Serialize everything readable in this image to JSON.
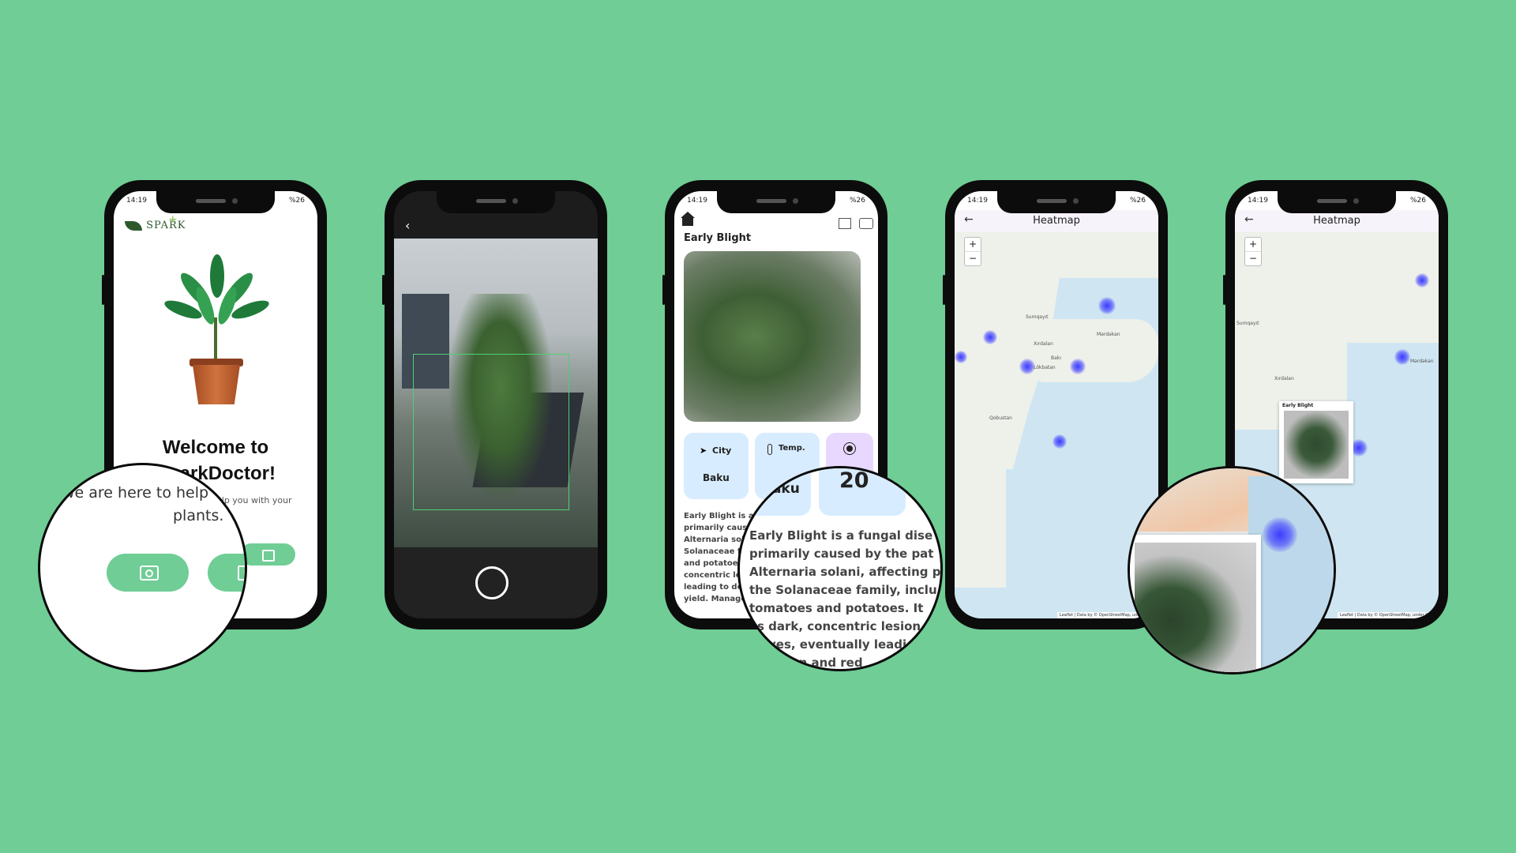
{
  "status": {
    "time": "14:19",
    "battery": "%26"
  },
  "welcome": {
    "logo": "SPARK",
    "title": "Welcome to SparkDoctor!",
    "subtitle": "We are here to help you with your plants.",
    "magnified_text_1": "we are here to help",
    "magnified_text_2": "plants."
  },
  "detail": {
    "title": "Early Blight",
    "city_label": "City",
    "city_value": "Baku",
    "temp_label": "Temp.",
    "temp_value": "20",
    "description": "Early Blight is a fungal disease primarily caused by the pathogen Alternaria solani, affecting plants in the Solanaceae family, including tomatoes and potatoes. It appears as dark, concentric lesions on leaves, eventually leading to defoliation and reduced yield. Manage Early...",
    "mag_lines": [
      "Early Blight is a fungal dise",
      "primarily caused by the pat",
      "Alternaria solani, affecting p",
      "the Solanaceae family, inclu",
      "tomatoes and potatoes. It",
      "s dark, concentric lesion",
      "ves, eventually leadi",
      "tion and red"
    ]
  },
  "heatmap": {
    "title": "Heatmap",
    "zoom_in": "+",
    "zoom_out": "−",
    "popup_title": "Early Blight",
    "places": [
      "Sumqayıt",
      "Xırdalan",
      "Bakı",
      "Lökbatan",
      "Qobustan",
      "Mərdəkan"
    ],
    "attribution": "Leaflet | Data by © OpenStreetMap, under ODbL"
  },
  "colors": {
    "background": "#6fcd95",
    "accent": "#6fcd95",
    "card_blue": "#d8ecff",
    "card_purple": "#e8d8ff"
  }
}
